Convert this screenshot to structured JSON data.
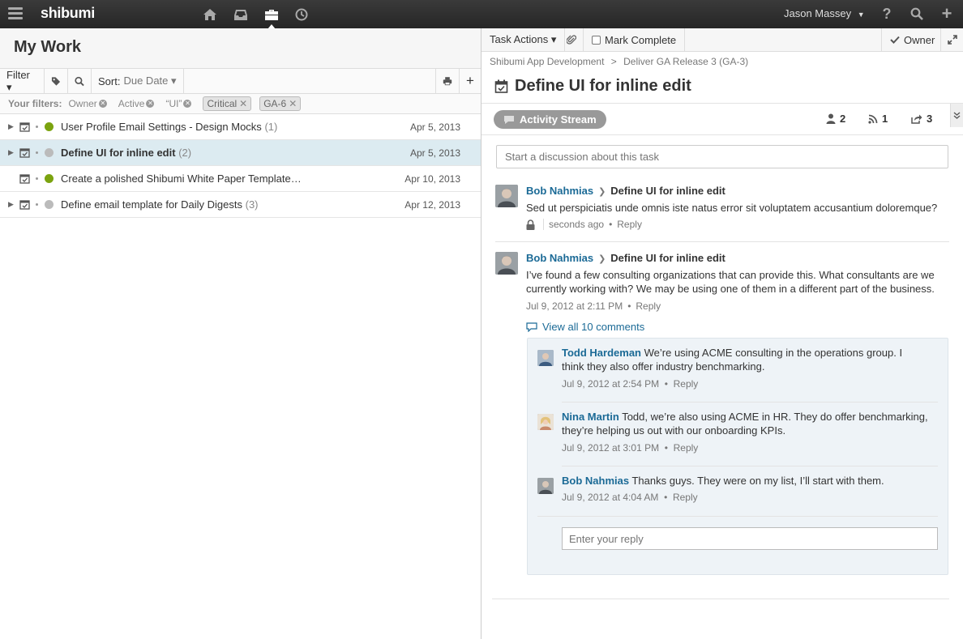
{
  "topbar": {
    "logo": "shibumi",
    "user_name": "Jason Massey",
    "user_caret": "▼",
    "help_label": "?",
    "add_label": "+"
  },
  "left": {
    "page_title": "My Work",
    "toolbar": {
      "filter_label": "Filter ▾",
      "sort_prefix": "Sort:",
      "sort_value": "Due Date ▾",
      "add_label": "+"
    },
    "filters": {
      "label": "Your filters:",
      "items": [
        "Owner",
        "Active",
        "“UI”"
      ],
      "tags": [
        "Critical",
        "GA-6"
      ]
    },
    "tasks": [
      {
        "title": "User Profile Email Settings - Design Mocks",
        "count": "(1)",
        "date": "Apr 5, 2013",
        "status_color": "#7ba30f",
        "has_caret": true,
        "selected": false
      },
      {
        "title": "Define UI for inline edit",
        "count": "(2)",
        "date": "Apr 5, 2013",
        "status_color": "#bbbbbb",
        "has_caret": true,
        "selected": true
      },
      {
        "title": "Create a polished Shibumi White Paper Template…",
        "count": "",
        "date": "Apr 10, 2013",
        "status_color": "#7ba30f",
        "has_caret": false,
        "selected": false
      },
      {
        "title": "Define email template for Daily Digests",
        "count": "(3)",
        "date": "Apr 12, 2013",
        "status_color": "#bbbbbb",
        "has_caret": true,
        "selected": false
      }
    ]
  },
  "right": {
    "toolbar": {
      "task_actions": "Task Actions ▾",
      "mark_complete": "Mark Complete",
      "owner": "Owner"
    },
    "breadcrumb": {
      "project": "Shibumi App Development",
      "sep": ">",
      "release": "Deliver GA Release 3 (GA-3)"
    },
    "title": "Define UI for inline edit",
    "stream": {
      "label": "Activity Stream",
      "people_count": "2",
      "feed_count": "1",
      "share_count": "3"
    },
    "discussion_placeholder": "Start a discussion about this task",
    "posts": [
      {
        "author": "Bob Nahmias",
        "task": "Define UI for inline edit",
        "body": "Sed ut perspiciatis unde omnis iste natus error sit voluptatem accusantium doloremque?",
        "time": "seconds ago",
        "reply": "Reply"
      },
      {
        "author": "Bob Nahmias",
        "task": "Define UI for inline edit",
        "body": "I’ve found a few consulting organizations that can provide this. What consultants are we currently working with? We may be using one of them in a different part of the business.",
        "time": "Jul 9, 2012 at 2:11 PM",
        "reply": "Reply",
        "view_all": "View all 10 comments"
      }
    ],
    "comments": [
      {
        "author": "Todd Hardeman",
        "text": "We’re using ACME consulting in the operations group. I think they also offer industry benchmarking.",
        "time": "Jul 9, 2012 at 2:54 PM",
        "reply": "Reply"
      },
      {
        "author": "Nina Martin",
        "text": "Todd, we’re also using ACME in HR. They do offer benchmarking, they’re helping us out with our onboarding KPIs.",
        "time": "Jul 9, 2012 at 3:01 PM",
        "reply": "Reply"
      },
      {
        "author": "Bob Nahmias",
        "text": "Thanks guys. They were on my list, I’ll start with them.",
        "time": "Jul 9, 2012 at 4:04 AM",
        "reply": "Reply"
      }
    ],
    "reply_placeholder": "Enter your reply"
  }
}
